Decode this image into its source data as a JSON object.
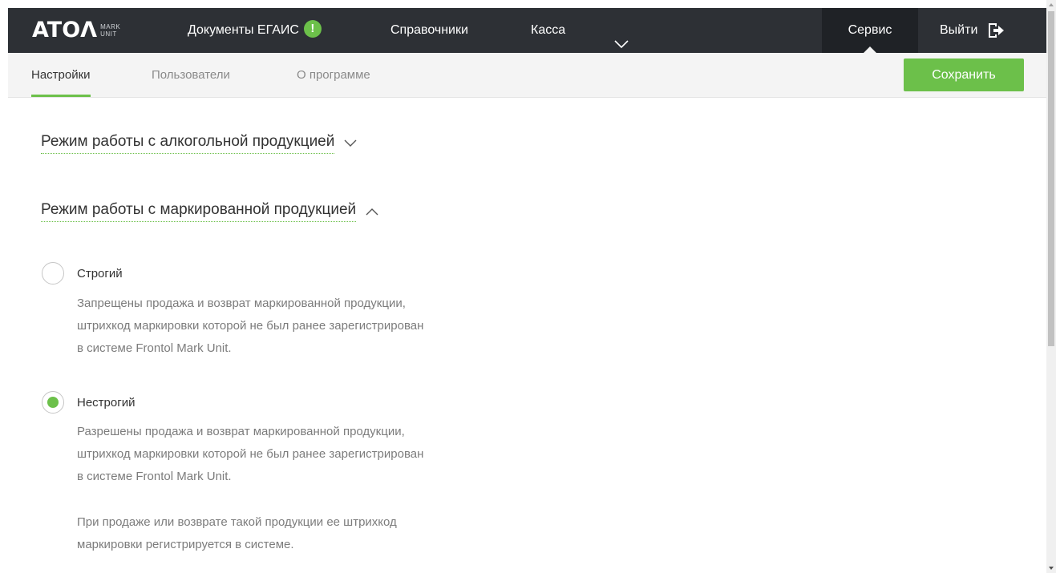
{
  "header": {
    "logo": {
      "mark": "ATOΛ",
      "sub_top": "MARK",
      "sub_bottom": "UNIT"
    },
    "nav": {
      "docs_label": "Документы ЕГАИС",
      "docs_badge": "!",
      "refs_label": "Справочники",
      "cash_label": "Касса",
      "more_icon": "chevron-down-icon"
    },
    "service_label": "Сервис",
    "logout_label": "Выйти",
    "logout_icon": "logout-icon"
  },
  "subnav": {
    "tabs": [
      {
        "label": "Настройки",
        "active": true
      },
      {
        "label": "Пользователи",
        "active": false
      },
      {
        "label": "О программе",
        "active": false
      }
    ],
    "save_label": "Сохранить"
  },
  "content": {
    "sections": [
      {
        "title": "Режим работы с алкогольной продукцией",
        "expanded": false
      },
      {
        "title": "Режим работы с маркированной продукцией",
        "expanded": true
      }
    ],
    "modes": [
      {
        "label": "Строгий",
        "selected": false,
        "description": [
          "Запрещены продажа и возврат маркированной продукции,",
          "штрихкод маркировки которой не был ранее зарегистрирован",
          "в системе Frontol Mark Unit."
        ]
      },
      {
        "label": "Нестрогий",
        "selected": true,
        "description": [
          "Разрешены продажа и возврат маркированной продукции,",
          "штрихкод маркировки которой не был ранее зарегистрирован",
          "в системе Frontol Mark Unit."
        ],
        "extra": [
          "При продаже или возврате такой продукции ее штрихкод",
          "маркировки регистрируется в системе."
        ]
      }
    ]
  },
  "colors": {
    "topbar": "#2d3035",
    "accent": "#6cc04a",
    "subbar": "#f4f4f4",
    "muted_text": "#7c7c7c"
  }
}
